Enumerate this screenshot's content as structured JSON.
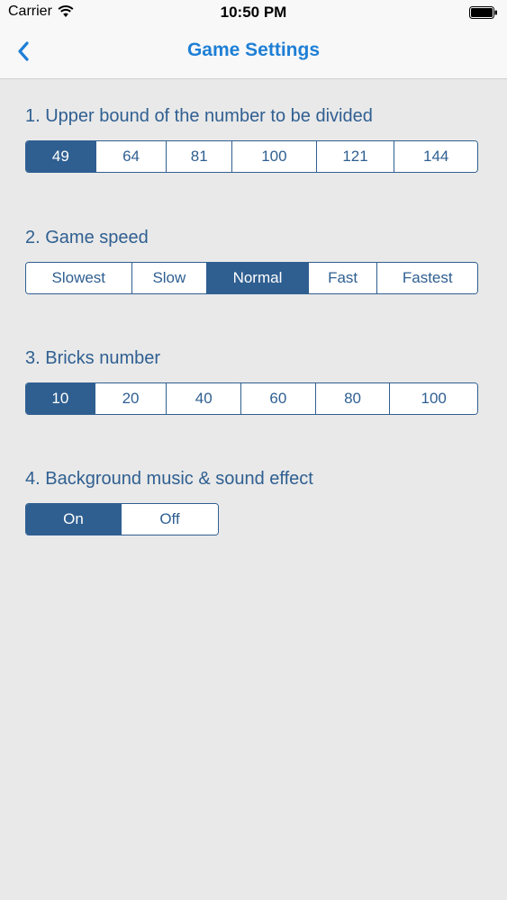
{
  "status_bar": {
    "carrier": "Carrier",
    "time": "10:50 PM",
    "wifi_icon": "wifi-icon",
    "battery_icon": "battery-icon"
  },
  "nav": {
    "title": "Game Settings",
    "back_icon": "chevron-left-icon"
  },
  "colors": {
    "accent": "#1e7fd6",
    "segment": "#2f5f91",
    "background": "#e9e9e9"
  },
  "settings": [
    {
      "title": "1. Upper bound of the number to be divided",
      "options": [
        "49",
        "64",
        "81",
        "100",
        "121",
        "144"
      ],
      "selected": "49"
    },
    {
      "title": "2. Game speed",
      "options": [
        "Slowest",
        "Slow",
        "Normal",
        "Fast",
        "Fastest"
      ],
      "selected": "Normal"
    },
    {
      "title": "3. Bricks number",
      "options": [
        "10",
        "20",
        "40",
        "60",
        "80",
        "100"
      ],
      "selected": "10"
    },
    {
      "title": "4. Background music & sound effect",
      "options": [
        "On",
        "Off"
      ],
      "selected": "On"
    }
  ]
}
